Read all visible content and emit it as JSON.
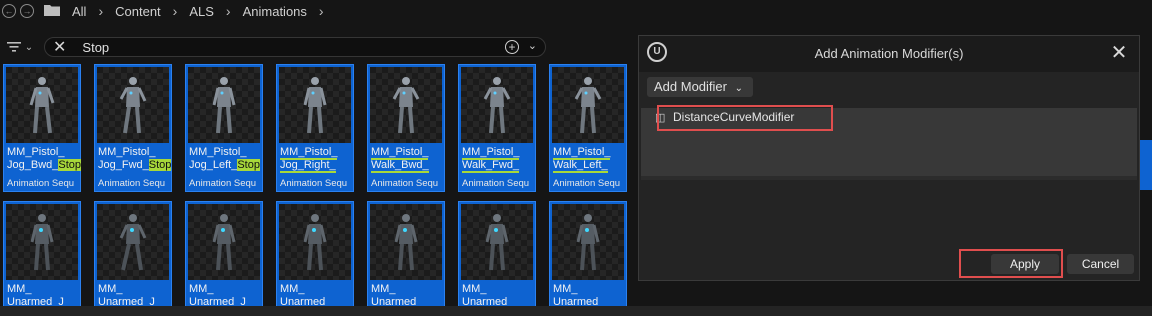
{
  "breadcrumb": {
    "items": [
      "All",
      "Content",
      "ALS",
      "Animations"
    ]
  },
  "search": {
    "value": "Stop"
  },
  "tiles_row1": [
    {
      "name_pre": "MM_Pistol_\nJog_Bwd_",
      "name_hl": "Stop",
      "type": "Animation Sequ"
    },
    {
      "name_pre": "MM_Pistol_\nJog_Fwd_",
      "name_hl": "Stop",
      "type": "Animation Sequ"
    },
    {
      "name_pre": "MM_Pistol_\nJog_Left_",
      "name_hl": "Stop",
      "type": "Animation Sequ"
    },
    {
      "name_pre": "MM_Pistol_\nJog_Right_",
      "name_hl": "",
      "type": "Animation Sequ"
    },
    {
      "name_pre": "MM_Pistol_\nWalk_Bwd_",
      "name_hl": "",
      "type": "Animation Sequ"
    },
    {
      "name_pre": "MM_Pistol_\nWalk_Fwd_",
      "name_hl": "",
      "type": "Animation Sequ"
    },
    {
      "name_pre": "MM_Pistol_\nWalk_Left_",
      "name_hl": "",
      "type": "Animation Sequ"
    }
  ],
  "tiles_row2": [
    {
      "name": "MM_\nUnarmed_J"
    },
    {
      "name": "MM_\nUnarmed_J"
    },
    {
      "name": "MM_\nUnarmed_J"
    },
    {
      "name": "MM_\nUnarmed_"
    },
    {
      "name": "MM_\nUnarmed_"
    },
    {
      "name": "MM_\nUnarmed_"
    },
    {
      "name": "MM_\nUnarmed_"
    }
  ],
  "dialog": {
    "title": "Add Animation Modifier(s)",
    "add_modifier_label": "Add Modifier",
    "modifier_item": "DistanceCurveModifier",
    "apply_label": "Apply",
    "cancel_label": "Cancel"
  },
  "colors": {
    "accent": "#0e63d1",
    "highlight": "#a7d83a",
    "annotation": "#e04e4e"
  }
}
